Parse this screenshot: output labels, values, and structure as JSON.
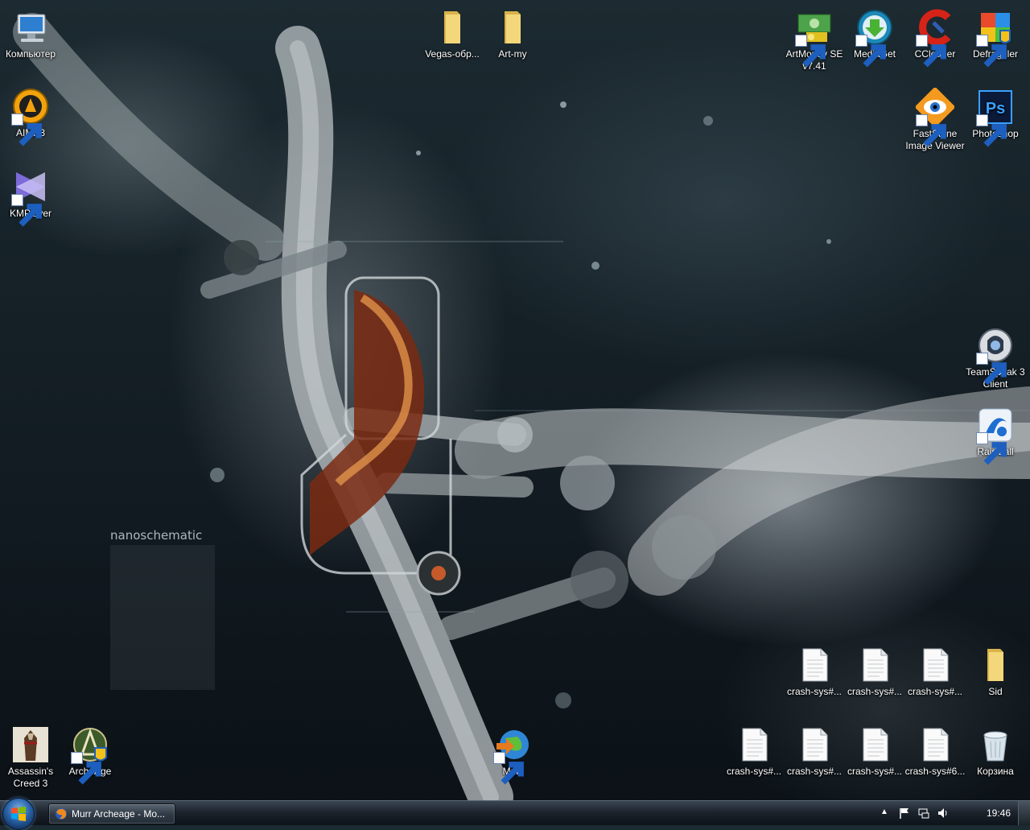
{
  "desktop": {
    "icons": [
      {
        "id": "computer",
        "label": "Компьютер"
      },
      {
        "id": "aimp3",
        "label": "AIMP3"
      },
      {
        "id": "kmplayer",
        "label": "KMPlayer"
      },
      {
        "id": "vegas",
        "label": "Vegas-обр..."
      },
      {
        "id": "artmy",
        "label": "Art-my"
      },
      {
        "id": "artmoney",
        "label": "ArtMoney SE v7.41"
      },
      {
        "id": "mediaget",
        "label": "MediaGet"
      },
      {
        "id": "ccleaner",
        "label": "CCleaner"
      },
      {
        "id": "defraggler",
        "label": "Defraggler"
      },
      {
        "id": "faststone",
        "label": "FastStone Image Viewer"
      },
      {
        "id": "photoshop",
        "label": "Photoshop"
      },
      {
        "id": "teamspeak",
        "label": "TeamSpeak 3 Client"
      },
      {
        "id": "raidcall",
        "label": "RaidCall"
      },
      {
        "id": "crash1",
        "label": "crash-sys#..."
      },
      {
        "id": "crash2",
        "label": "crash-sys#..."
      },
      {
        "id": "crash3",
        "label": "crash-sys#..."
      },
      {
        "id": "sid",
        "label": "Sid"
      },
      {
        "id": "crash4",
        "label": "crash-sys#..."
      },
      {
        "id": "crash5",
        "label": "crash-sys#..."
      },
      {
        "id": "crash6",
        "label": "crash-sys#..."
      },
      {
        "id": "crash7",
        "label": "crash-sys#6..."
      },
      {
        "id": "recycle",
        "label": "Корзина"
      },
      {
        "id": "assassins",
        "label": "Assassin's Creed 3"
      },
      {
        "id": "archeage",
        "label": "ArcheAge"
      },
      {
        "id": "murr",
        "label": "Murr"
      }
    ],
    "wallpaper_text": "nanoschematic"
  },
  "taskbar": {
    "window_button_label": "Murr Archeage - Mo...",
    "clock": "19:46",
    "tray_expand": "▲"
  },
  "colors": {
    "folder": "#e8c860",
    "accent": "#2a64a9"
  }
}
